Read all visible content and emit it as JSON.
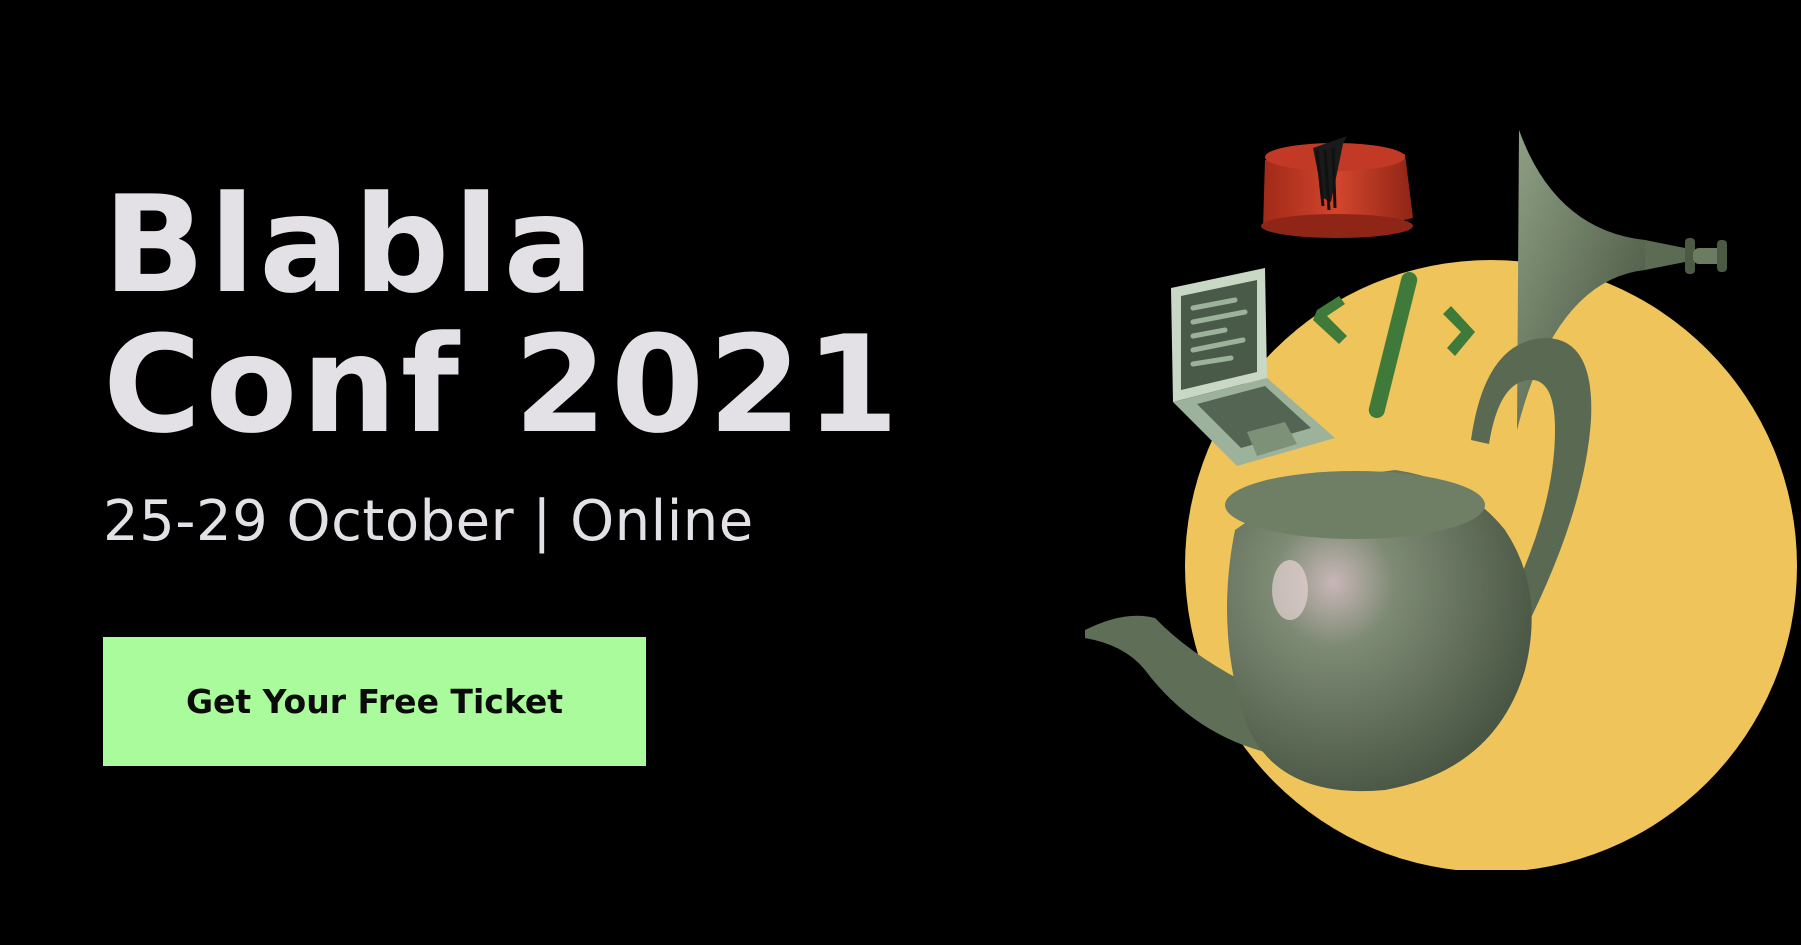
{
  "event": {
    "title_line_1": "Blabla",
    "title_line_2": "Conf 2021",
    "date_location": "25-29 October | Online",
    "cta_label": "Get Your Free Ticket"
  },
  "colors": {
    "background": "#000000",
    "title_text": "#e3e1e6",
    "cta_background": "#aafb9b",
    "cta_text": "#0b0b0b",
    "circle": "#efc55b",
    "pot": "#6b7c62",
    "code_symbol": "#3f7a3a",
    "fez": "#c23a25",
    "laptop": "#9db29a"
  },
  "illustration": {
    "icons": [
      "fez-hat-icon",
      "laptop-icon",
      "code-brackets-icon",
      "teapot-icon",
      "gramophone-horn-icon"
    ]
  }
}
